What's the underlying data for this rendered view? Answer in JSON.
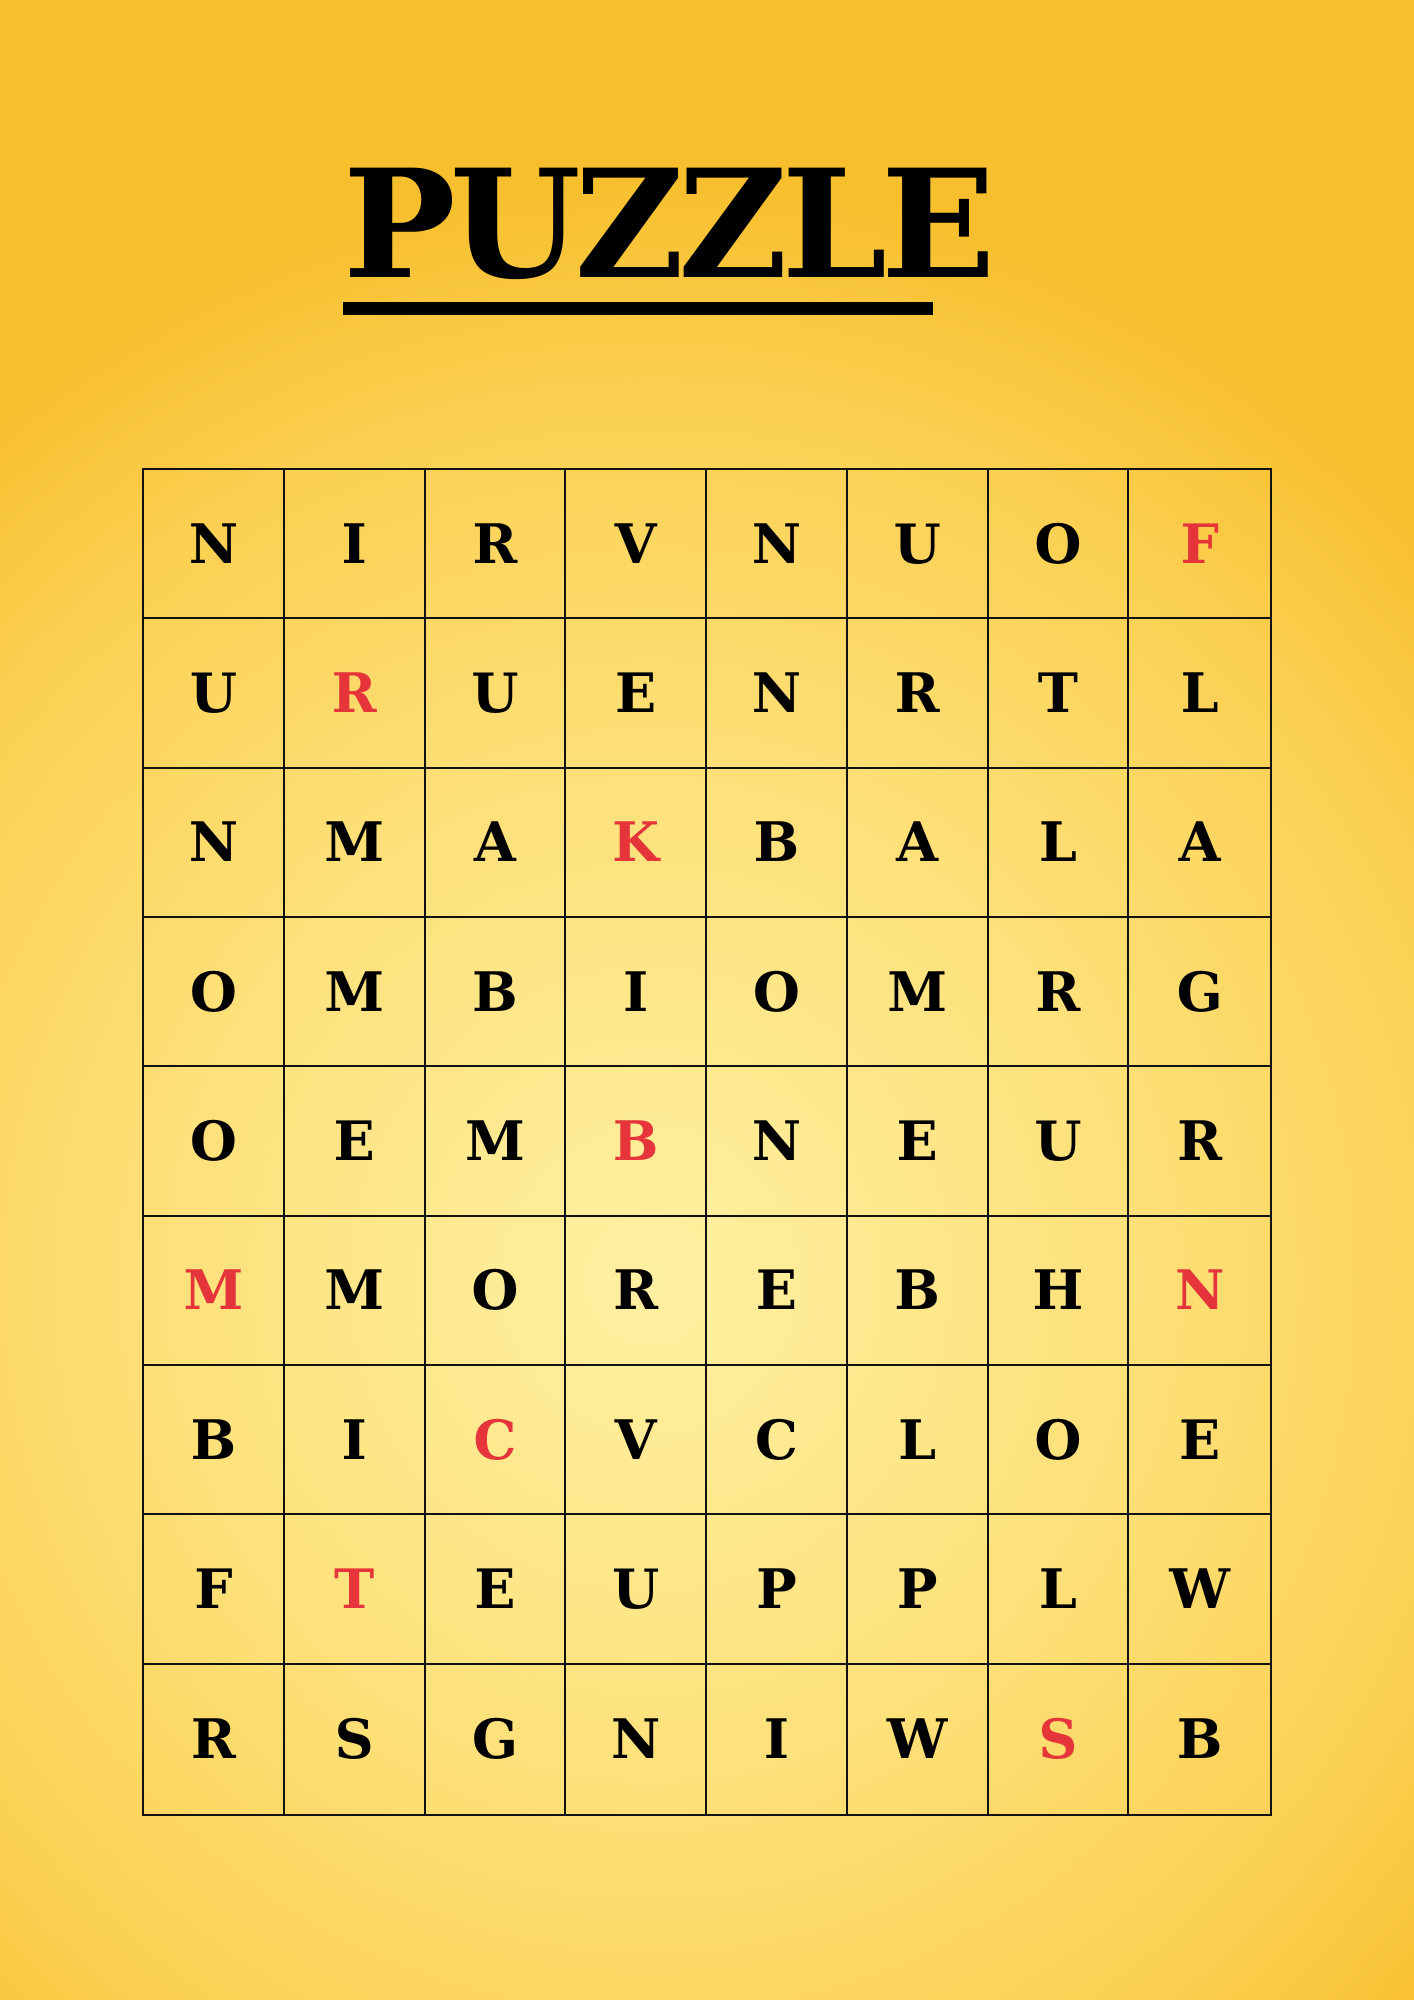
{
  "title": "PUZZLE",
  "colors": {
    "letter": "#000000",
    "highlight": "#e5353a",
    "background_center": "#fef0a2",
    "background_edge": "#f7bf2d",
    "grid_line": "#111111"
  },
  "grid": {
    "rows": [
      [
        "N",
        "I",
        "R",
        "V",
        "N",
        "U",
        "O",
        "F"
      ],
      [
        "U",
        "R",
        "U",
        "E",
        "N",
        "R",
        "T",
        "L"
      ],
      [
        "N",
        "M",
        "A",
        "K",
        "B",
        "A",
        "L",
        "A"
      ],
      [
        "O",
        "M",
        "B",
        "I",
        "O",
        "M",
        "R",
        "G"
      ],
      [
        "O",
        "E",
        "M",
        "B",
        "N",
        "E",
        "U",
        "R"
      ],
      [
        "M",
        "M",
        "O",
        "R",
        "E",
        "B",
        "H",
        "N"
      ],
      [
        "B",
        "I",
        "C",
        "V",
        "C",
        "L",
        "O",
        "E"
      ],
      [
        "F",
        "T",
        "E",
        "U",
        "P",
        "P",
        "L",
        "W"
      ],
      [
        "R",
        "S",
        "G",
        "N",
        "I",
        "W",
        "S",
        "B"
      ]
    ],
    "highlighted": [
      [
        0,
        7
      ],
      [
        1,
        1
      ],
      [
        2,
        3
      ],
      [
        4,
        3
      ],
      [
        5,
        0
      ],
      [
        5,
        7
      ],
      [
        6,
        2
      ],
      [
        7,
        1
      ],
      [
        8,
        6
      ]
    ]
  }
}
